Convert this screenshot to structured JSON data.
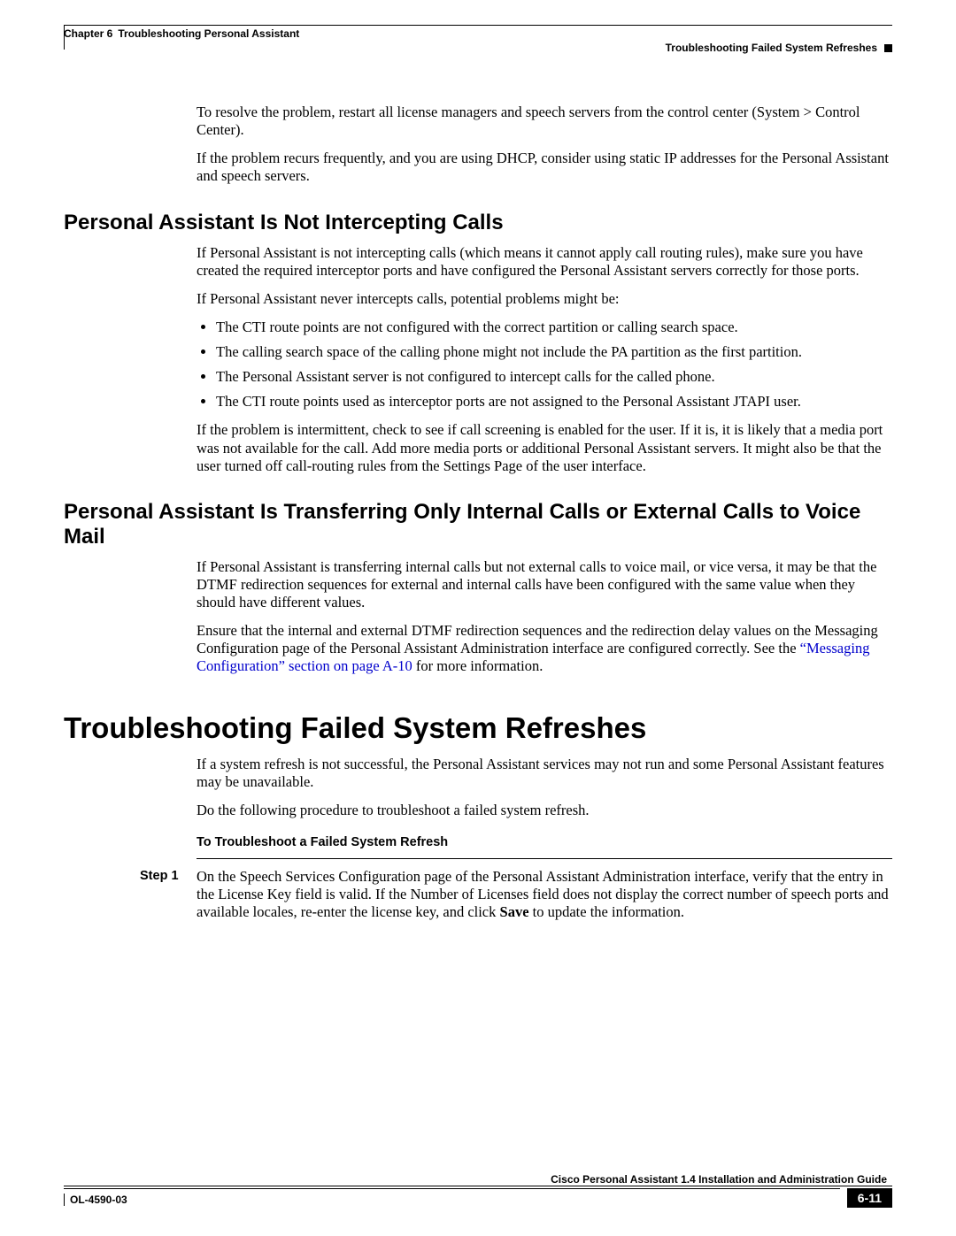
{
  "header": {
    "chapter_label": "Chapter 6",
    "chapter_title": "Troubleshooting Personal Assistant",
    "running_head": "Troubleshooting Failed System Refreshes"
  },
  "intro": {
    "p1": "To resolve the problem, restart all license managers and speech servers from the control center (System > Control Center).",
    "p2": "If the problem recurs frequently, and you are using DHCP, consider using static IP addresses for the Personal Assistant and speech servers."
  },
  "section1": {
    "title": "Personal Assistant Is Not Intercepting Calls",
    "p1": "If Personal Assistant is not intercepting calls (which means it cannot apply call routing rules), make sure you have created the required interceptor ports and have configured the Personal Assistant servers correctly for those ports.",
    "p2": "If Personal Assistant never intercepts calls, potential problems might be:",
    "bullets": [
      "The CTI route points are not configured with the correct partition or calling search space.",
      "The calling search space of the calling phone might not include the PA partition as the first partition.",
      "The Personal Assistant server is not configured to intercept calls for the called phone.",
      "The CTI route points used as interceptor ports are not assigned to the Personal Assistant JTAPI user."
    ],
    "p3": "If the problem is intermittent, check to see if call screening is enabled for the user. If it is, it is likely that a media port was not available for the call. Add more media ports or additional Personal Assistant servers. It might also be that the user turned off call-routing rules from the Settings Page of the user interface."
  },
  "section2": {
    "title": "Personal Assistant Is Transferring Only Internal Calls or External Calls to Voice Mail",
    "p1": "If Personal Assistant is transferring internal calls but not external calls to voice mail, or vice versa, it may be that the DTMF redirection sequences for external and internal calls have been configured with the same value when they should have different values.",
    "p2a": "Ensure that the internal and external DTMF redirection sequences and the redirection delay values on the Messaging Configuration page of the Personal Assistant Administration interface are configured correctly. See the ",
    "link": "“Messaging Configuration” section on page A-10",
    "p2b": " for more information."
  },
  "section3": {
    "title": "Troubleshooting Failed System Refreshes",
    "p1": "If a system refresh is not successful, the Personal Assistant services may not run and some Personal Assistant features may be unavailable.",
    "p2": "Do the following procedure to troubleshoot a failed system refresh.",
    "subhead": "To Troubleshoot a Failed System Refresh",
    "step_label": "Step 1",
    "step_body_a": "On the Speech Services Configuration page of the Personal Assistant Administration interface, verify that the entry in the License Key field is valid. If the Number of Licenses field does not display the correct number of speech ports and available locales, re-enter the license key, and click ",
    "step_bold": "Save",
    "step_body_b": " to update the information."
  },
  "footer": {
    "guide_title": "Cisco Personal Assistant 1.4 Installation and Administration Guide",
    "doc_id": "OL-4590-03",
    "page_num": "6-11"
  }
}
